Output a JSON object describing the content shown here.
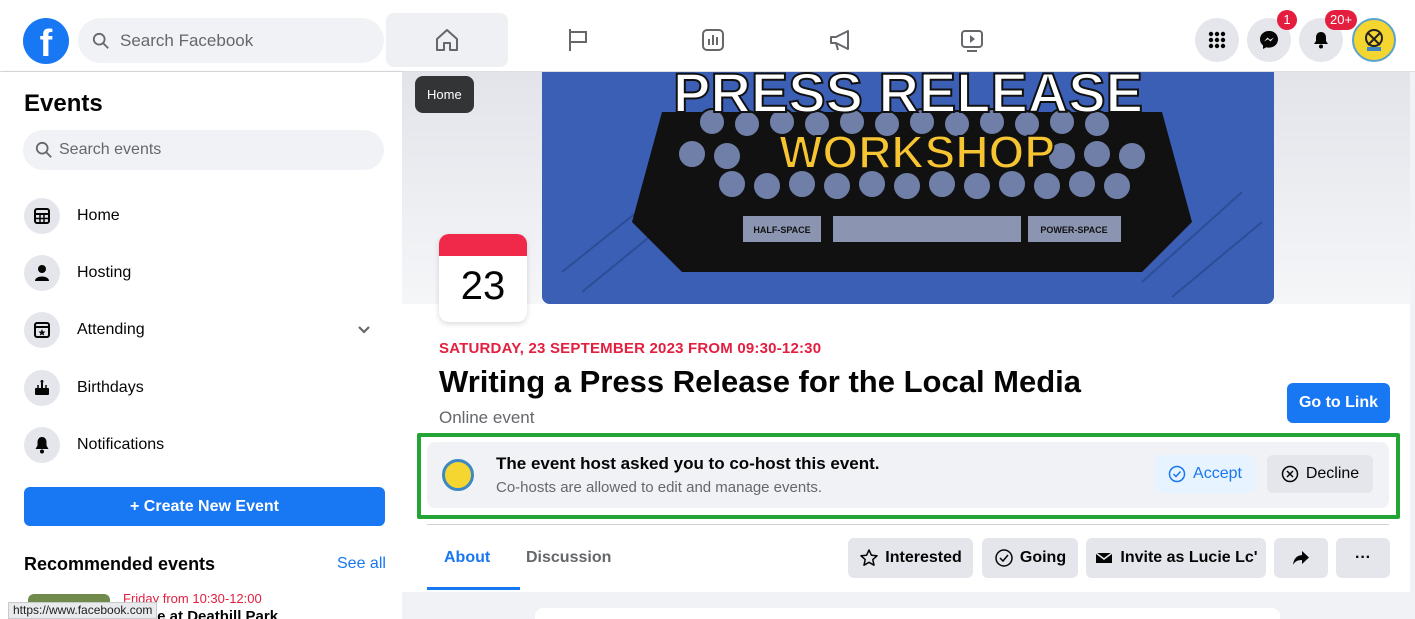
{
  "topbar": {
    "logo": "f",
    "search_placeholder": "Search Facebook",
    "nav_icons": [
      "home-icon",
      "flag-icon",
      "chart-icon",
      "megaphone-icon",
      "play-icon"
    ],
    "messenger_badge": "1",
    "notifications_badge": "20+",
    "brand_color": "#1877f2"
  },
  "tooltip": "Home",
  "sidebar": {
    "title": "Events",
    "search_placeholder": "Search events",
    "items": [
      {
        "label": "Home",
        "icon": "calendar-grid-icon"
      },
      {
        "label": "Hosting",
        "icon": "person-icon"
      },
      {
        "label": "Attending",
        "icon": "star-calendar-icon"
      },
      {
        "label": "Birthdays",
        "icon": "cake-icon"
      },
      {
        "label": "Notifications",
        "icon": "bell-icon"
      }
    ],
    "create_label": "+  Create New Event",
    "recommended_title": "Recommended events",
    "see_all": "See all",
    "rec_date": "Friday from 10:30-12:00",
    "rec_name": "... age at Deathill Park",
    "url_tooltip": "https://www.facebook.com"
  },
  "event": {
    "cover_text_top": "PRESS RELEASE",
    "cover_text_sub": "WORKSHOP",
    "cover_key_left": "HALF-SPACE",
    "cover_key_right": "POWER-SPACE",
    "day": "23",
    "datetime": "SATURDAY, 23 SEPTEMBER 2023 FROM 09:30-12:30",
    "title": "Writing a Press Release for the Local Media",
    "subtitle": "Online event",
    "go_link": "Go to Link"
  },
  "cohost": {
    "title": "The event host asked you to co-host this event.",
    "subtitle": "Co-hosts are allowed to edit and manage events.",
    "accept": "Accept",
    "decline": "Decline"
  },
  "tabs": {
    "about": "About",
    "discussion": "Discussion"
  },
  "actions": {
    "interested": "Interested",
    "going": "Going",
    "invite": "Invite as Lucie Lc'",
    "more": "···"
  }
}
